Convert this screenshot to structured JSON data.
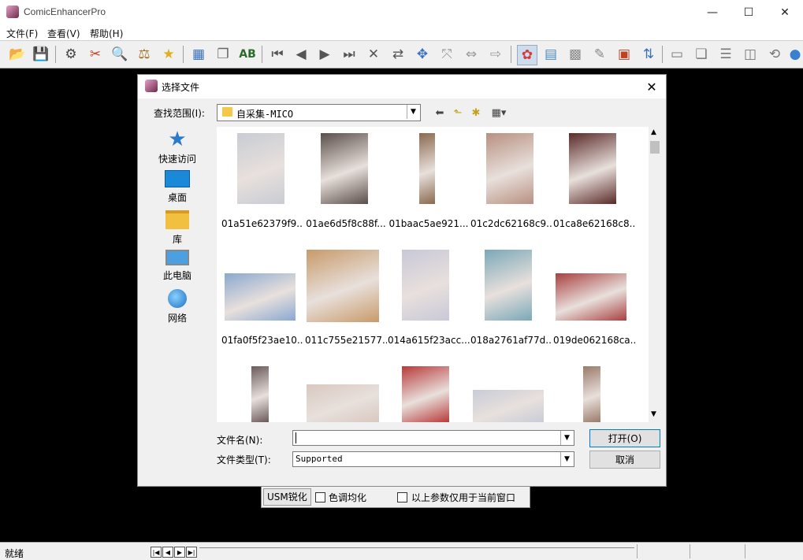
{
  "app": {
    "title": "ComicEnhancerPro",
    "menu": [
      "文件(F)",
      "查看(V)",
      "帮助(H)"
    ],
    "status": "就绪"
  },
  "options": {
    "usm": "USM锐化",
    "tone_equalize": "色调均化",
    "apply_current": "以上参数仅用于当前窗口"
  },
  "dialog": {
    "title": "选择文件",
    "lookin_label": "查找范围(I):",
    "lookin_value": "自采集-MICO",
    "places": [
      "快速访问",
      "桌面",
      "库",
      "此电脑",
      "网络"
    ],
    "filename_label": "文件名(N):",
    "filename_value": "",
    "filetype_label": "文件类型(T):",
    "filetype_value": "Supported",
    "open_button": "打开(O)",
    "cancel_button": "取消",
    "files": [
      {
        "name": "01a51e62379f9..."
      },
      {
        "name": "01ae6d5f8c88f..."
      },
      {
        "name": "01baac5ae921..."
      },
      {
        "name": "01c2dc62168c9..."
      },
      {
        "name": "01ca8e62168c8..."
      },
      {
        "name": "01fa0f5f23ae10..."
      },
      {
        "name": "011c755e21577..."
      },
      {
        "name": "014a615f23acc..."
      },
      {
        "name": "018a2761af77d..."
      },
      {
        "name": "019de062168ca..."
      },
      {
        "name": ""
      },
      {
        "name": ""
      },
      {
        "name": ""
      },
      {
        "name": ""
      },
      {
        "name": ""
      }
    ]
  },
  "colors": {
    "thumb_1": "#c8ccd4",
    "thumb_2": "#5a4e4a",
    "thumb_3": "#8a6a50",
    "thumb_4": "#b89080",
    "thumb_5": "#5a2a28",
    "thumb_6": "#8aa8d0",
    "thumb_7": "#c89a6a",
    "thumb_8": "#c8c8d8",
    "thumb_9": "#7aa8b8",
    "thumb_10": "#a84040",
    "thumb_11": "#6a5a5a",
    "thumb_12": "#d8c8c0",
    "thumb_13": "#b83a3a",
    "thumb_14": "#c8ccd8",
    "thumb_15": "#9a7a6a"
  }
}
